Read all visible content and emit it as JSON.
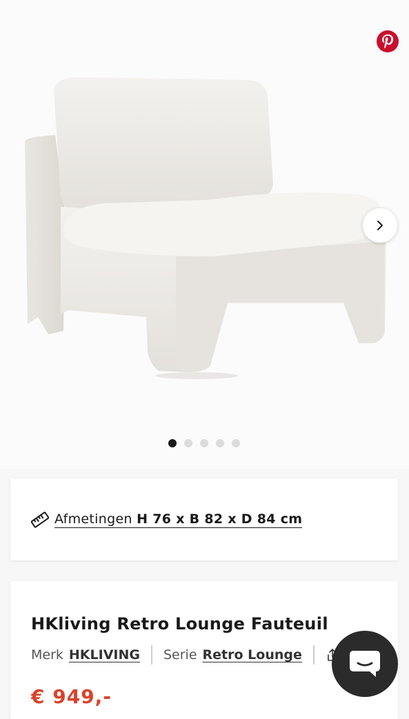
{
  "gallery": {
    "image_alt": "HKliving Retro Lounge Fauteuil",
    "dots_total": 5,
    "active_dot": 1
  },
  "dimensions": {
    "label": "Afmetingen",
    "value": "H 76 x B 82 x D 84 cm"
  },
  "product": {
    "title": "HKliving Retro Lounge Fauteuil",
    "brand_label": "Merk",
    "brand_value": "HKLIVING",
    "series_label": "Serie",
    "series_value": "Retro Lounge",
    "price": "€ 949,-"
  },
  "colors": {
    "price": "#d9432c",
    "pinterest": "#c8102e",
    "chat": "#2b2b2b"
  }
}
